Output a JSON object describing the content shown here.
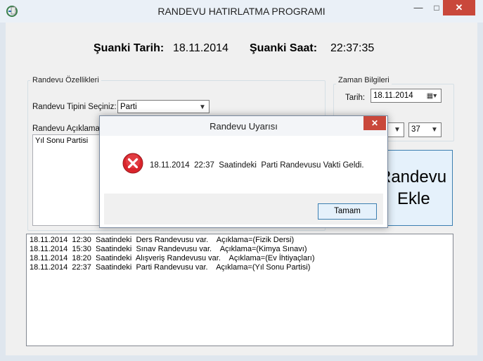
{
  "window": {
    "title": "RANDEVU HATIRLATMA PROGRAMI",
    "minimize": "—",
    "maximize": "□",
    "close": "✕"
  },
  "header": {
    "date_label": "Şuanki Tarih:",
    "date_value": "18.11.2014",
    "time_label": "Şuanki Saat:",
    "time_value": "22:37:35"
  },
  "properties": {
    "group_label": "Randevu Özellikleri",
    "type_label": "Randevu Tipini Seçiniz:",
    "type_value": "Parti",
    "desc_label": "Randevu Açıklaması",
    "desc_value": "Yıl Sonu Partisi"
  },
  "time_info": {
    "group_label": "Zaman Bilgileri",
    "date_label": "Tarih:",
    "date_value": "18.11.2014",
    "minute_value": "37"
  },
  "add_button": {
    "line1": "Randevu",
    "line2": "Ekle"
  },
  "log": [
    "18.11.2014  12:30  Saatindeki  Ders Randevusu var.    Açıklama=(Fizik Dersi)",
    "18.11.2014  15:30  Saatindeki  Sınav Randevusu var.    Açıklama=(Kimya Sınavı)",
    "18.11.2014  18:20  Saatindeki  Alışveriş Randevusu var.    Açıklama=(Ev İhtiyaçları)",
    "18.11.2014  22:37  Saatindeki  Parti Randevusu var.    Açıklama=(Yıl Sonu Partisi)"
  ],
  "dialog": {
    "title": "Randevu Uyarısı",
    "close": "✕",
    "message": "18.11.2014  22:37  Saatindeki  Parti Randevusu Vakti Geldi.",
    "ok_label": "Tamam"
  },
  "colors": {
    "close_red": "#c9483b",
    "button_blue_border": "#3c7fb1",
    "error_red": "#d9242b"
  }
}
